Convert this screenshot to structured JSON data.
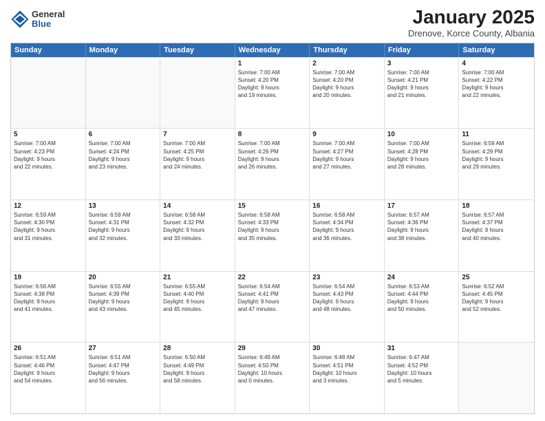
{
  "logo": {
    "general": "General",
    "blue": "Blue"
  },
  "header": {
    "title": "January 2025",
    "subtitle": "Drenove, Korce County, Albania"
  },
  "weekdays": [
    "Sunday",
    "Monday",
    "Tuesday",
    "Wednesday",
    "Thursday",
    "Friday",
    "Saturday"
  ],
  "weeks": [
    [
      {
        "day": "",
        "lines": []
      },
      {
        "day": "",
        "lines": []
      },
      {
        "day": "",
        "lines": []
      },
      {
        "day": "1",
        "lines": [
          "Sunrise: 7:00 AM",
          "Sunset: 4:20 PM",
          "Daylight: 9 hours",
          "and 19 minutes."
        ]
      },
      {
        "day": "2",
        "lines": [
          "Sunrise: 7:00 AM",
          "Sunset: 4:20 PM",
          "Daylight: 9 hours",
          "and 20 minutes."
        ]
      },
      {
        "day": "3",
        "lines": [
          "Sunrise: 7:00 AM",
          "Sunset: 4:21 PM",
          "Daylight: 9 hours",
          "and 21 minutes."
        ]
      },
      {
        "day": "4",
        "lines": [
          "Sunrise: 7:00 AM",
          "Sunset: 4:22 PM",
          "Daylight: 9 hours",
          "and 22 minutes."
        ]
      }
    ],
    [
      {
        "day": "5",
        "lines": [
          "Sunrise: 7:00 AM",
          "Sunset: 4:23 PM",
          "Daylight: 9 hours",
          "and 22 minutes."
        ]
      },
      {
        "day": "6",
        "lines": [
          "Sunrise: 7:00 AM",
          "Sunset: 4:24 PM",
          "Daylight: 9 hours",
          "and 23 minutes."
        ]
      },
      {
        "day": "7",
        "lines": [
          "Sunrise: 7:00 AM",
          "Sunset: 4:25 PM",
          "Daylight: 9 hours",
          "and 24 minutes."
        ]
      },
      {
        "day": "8",
        "lines": [
          "Sunrise: 7:00 AM",
          "Sunset: 4:26 PM",
          "Daylight: 9 hours",
          "and 26 minutes."
        ]
      },
      {
        "day": "9",
        "lines": [
          "Sunrise: 7:00 AM",
          "Sunset: 4:27 PM",
          "Daylight: 9 hours",
          "and 27 minutes."
        ]
      },
      {
        "day": "10",
        "lines": [
          "Sunrise: 7:00 AM",
          "Sunset: 4:28 PM",
          "Daylight: 9 hours",
          "and 28 minutes."
        ]
      },
      {
        "day": "11",
        "lines": [
          "Sunrise: 6:59 AM",
          "Sunset: 4:29 PM",
          "Daylight: 9 hours",
          "and 29 minutes."
        ]
      }
    ],
    [
      {
        "day": "12",
        "lines": [
          "Sunrise: 6:59 AM",
          "Sunset: 4:30 PM",
          "Daylight: 9 hours",
          "and 31 minutes."
        ]
      },
      {
        "day": "13",
        "lines": [
          "Sunrise: 6:59 AM",
          "Sunset: 4:31 PM",
          "Daylight: 9 hours",
          "and 32 minutes."
        ]
      },
      {
        "day": "14",
        "lines": [
          "Sunrise: 6:58 AM",
          "Sunset: 4:32 PM",
          "Daylight: 9 hours",
          "and 33 minutes."
        ]
      },
      {
        "day": "15",
        "lines": [
          "Sunrise: 6:58 AM",
          "Sunset: 4:33 PM",
          "Daylight: 9 hours",
          "and 35 minutes."
        ]
      },
      {
        "day": "16",
        "lines": [
          "Sunrise: 6:58 AM",
          "Sunset: 4:34 PM",
          "Daylight: 9 hours",
          "and 36 minutes."
        ]
      },
      {
        "day": "17",
        "lines": [
          "Sunrise: 6:57 AM",
          "Sunset: 4:36 PM",
          "Daylight: 9 hours",
          "and 38 minutes."
        ]
      },
      {
        "day": "18",
        "lines": [
          "Sunrise: 6:57 AM",
          "Sunset: 4:37 PM",
          "Daylight: 9 hours",
          "and 40 minutes."
        ]
      }
    ],
    [
      {
        "day": "19",
        "lines": [
          "Sunrise: 6:56 AM",
          "Sunset: 4:38 PM",
          "Daylight: 9 hours",
          "and 41 minutes."
        ]
      },
      {
        "day": "20",
        "lines": [
          "Sunrise: 6:55 AM",
          "Sunset: 4:39 PM",
          "Daylight: 9 hours",
          "and 43 minutes."
        ]
      },
      {
        "day": "21",
        "lines": [
          "Sunrise: 6:55 AM",
          "Sunset: 4:40 PM",
          "Daylight: 9 hours",
          "and 45 minutes."
        ]
      },
      {
        "day": "22",
        "lines": [
          "Sunrise: 6:54 AM",
          "Sunset: 4:41 PM",
          "Daylight: 9 hours",
          "and 47 minutes."
        ]
      },
      {
        "day": "23",
        "lines": [
          "Sunrise: 6:54 AM",
          "Sunset: 4:43 PM",
          "Daylight: 9 hours",
          "and 48 minutes."
        ]
      },
      {
        "day": "24",
        "lines": [
          "Sunrise: 6:53 AM",
          "Sunset: 4:44 PM",
          "Daylight: 9 hours",
          "and 50 minutes."
        ]
      },
      {
        "day": "25",
        "lines": [
          "Sunrise: 6:52 AM",
          "Sunset: 4:45 PM",
          "Daylight: 9 hours",
          "and 52 minutes."
        ]
      }
    ],
    [
      {
        "day": "26",
        "lines": [
          "Sunrise: 6:51 AM",
          "Sunset: 4:46 PM",
          "Daylight: 9 hours",
          "and 54 minutes."
        ]
      },
      {
        "day": "27",
        "lines": [
          "Sunrise: 6:51 AM",
          "Sunset: 4:47 PM",
          "Daylight: 9 hours",
          "and 56 minutes."
        ]
      },
      {
        "day": "28",
        "lines": [
          "Sunrise: 6:50 AM",
          "Sunset: 4:49 PM",
          "Daylight: 9 hours",
          "and 58 minutes."
        ]
      },
      {
        "day": "29",
        "lines": [
          "Sunrise: 6:49 AM",
          "Sunset: 4:50 PM",
          "Daylight: 10 hours",
          "and 0 minutes."
        ]
      },
      {
        "day": "30",
        "lines": [
          "Sunrise: 6:48 AM",
          "Sunset: 4:51 PM",
          "Daylight: 10 hours",
          "and 3 minutes."
        ]
      },
      {
        "day": "31",
        "lines": [
          "Sunrise: 6:47 AM",
          "Sunset: 4:52 PM",
          "Daylight: 10 hours",
          "and 5 minutes."
        ]
      },
      {
        "day": "",
        "lines": []
      }
    ]
  ]
}
